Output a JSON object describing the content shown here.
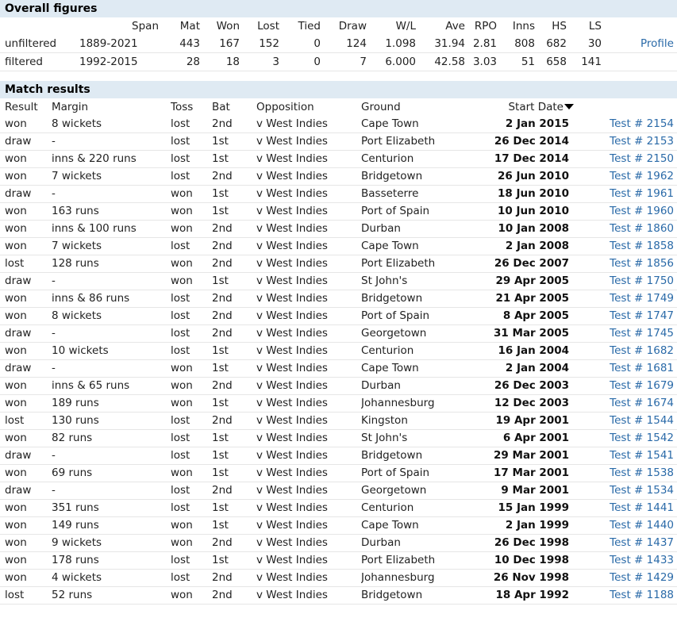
{
  "overall": {
    "title": "Overall figures",
    "headers": [
      "Span",
      "Mat",
      "Won",
      "Lost",
      "Tied",
      "Draw",
      "W/L",
      "Ave",
      "RPO",
      "Inns",
      "HS",
      "LS"
    ],
    "rows": [
      {
        "label": "unfiltered",
        "span": "1889-2021",
        "mat": "443",
        "won": "167",
        "lost": "152",
        "tied": "0",
        "draw": "124",
        "wl": "1.098",
        "ave": "31.94",
        "rpo": "2.81",
        "inns": "808",
        "hs": "682",
        "ls": "30",
        "link": "Profile"
      },
      {
        "label": "filtered",
        "span": "1992-2015",
        "mat": "28",
        "won": "18",
        "lost": "3",
        "tied": "0",
        "draw": "7",
        "wl": "6.000",
        "ave": "42.58",
        "rpo": "3.03",
        "inns": "51",
        "hs": "658",
        "ls": "141",
        "link": ""
      }
    ]
  },
  "results": {
    "title": "Match results",
    "headers": {
      "result": "Result",
      "margin": "Margin",
      "toss": "Toss",
      "bat": "Bat",
      "opposition": "Opposition",
      "ground": "Ground",
      "start_date": "Start Date"
    },
    "rows": [
      {
        "result": "won",
        "margin": "8 wickets",
        "toss": "lost",
        "bat": "2nd",
        "opposition": "v West Indies",
        "ground": "Cape Town",
        "date": "2 Jan 2015",
        "test": "Test # 2154"
      },
      {
        "result": "draw",
        "margin": "-",
        "toss": "lost",
        "bat": "1st",
        "opposition": "v West Indies",
        "ground": "Port Elizabeth",
        "date": "26 Dec 2014",
        "test": "Test # 2153"
      },
      {
        "result": "won",
        "margin": "inns & 220 runs",
        "toss": "lost",
        "bat": "1st",
        "opposition": "v West Indies",
        "ground": "Centurion",
        "date": "17 Dec 2014",
        "test": "Test # 2150"
      },
      {
        "result": "won",
        "margin": "7 wickets",
        "toss": "lost",
        "bat": "2nd",
        "opposition": "v West Indies",
        "ground": "Bridgetown",
        "date": "26 Jun 2010",
        "test": "Test # 1962"
      },
      {
        "result": "draw",
        "margin": "-",
        "toss": "won",
        "bat": "1st",
        "opposition": "v West Indies",
        "ground": "Basseterre",
        "date": "18 Jun 2010",
        "test": "Test # 1961"
      },
      {
        "result": "won",
        "margin": "163 runs",
        "toss": "won",
        "bat": "1st",
        "opposition": "v West Indies",
        "ground": "Port of Spain",
        "date": "10 Jun 2010",
        "test": "Test # 1960"
      },
      {
        "result": "won",
        "margin": "inns & 100 runs",
        "toss": "won",
        "bat": "2nd",
        "opposition": "v West Indies",
        "ground": "Durban",
        "date": "10 Jan 2008",
        "test": "Test # 1860"
      },
      {
        "result": "won",
        "margin": "7 wickets",
        "toss": "lost",
        "bat": "2nd",
        "opposition": "v West Indies",
        "ground": "Cape Town",
        "date": "2 Jan 2008",
        "test": "Test # 1858"
      },
      {
        "result": "lost",
        "margin": "128 runs",
        "toss": "won",
        "bat": "2nd",
        "opposition": "v West Indies",
        "ground": "Port Elizabeth",
        "date": "26 Dec 2007",
        "test": "Test # 1856"
      },
      {
        "result": "draw",
        "margin": "-",
        "toss": "won",
        "bat": "1st",
        "opposition": "v West Indies",
        "ground": "St John's",
        "date": "29 Apr 2005",
        "test": "Test # 1750"
      },
      {
        "result": "won",
        "margin": "inns & 86 runs",
        "toss": "lost",
        "bat": "2nd",
        "opposition": "v West Indies",
        "ground": "Bridgetown",
        "date": "21 Apr 2005",
        "test": "Test # 1749"
      },
      {
        "result": "won",
        "margin": "8 wickets",
        "toss": "lost",
        "bat": "2nd",
        "opposition": "v West Indies",
        "ground": "Port of Spain",
        "date": "8 Apr 2005",
        "test": "Test # 1747"
      },
      {
        "result": "draw",
        "margin": "-",
        "toss": "lost",
        "bat": "2nd",
        "opposition": "v West Indies",
        "ground": "Georgetown",
        "date": "31 Mar 2005",
        "test": "Test # 1745"
      },
      {
        "result": "won",
        "margin": "10 wickets",
        "toss": "lost",
        "bat": "1st",
        "opposition": "v West Indies",
        "ground": "Centurion",
        "date": "16 Jan 2004",
        "test": "Test # 1682"
      },
      {
        "result": "draw",
        "margin": "-",
        "toss": "won",
        "bat": "1st",
        "opposition": "v West Indies",
        "ground": "Cape Town",
        "date": "2 Jan 2004",
        "test": "Test # 1681"
      },
      {
        "result": "won",
        "margin": "inns & 65 runs",
        "toss": "won",
        "bat": "2nd",
        "opposition": "v West Indies",
        "ground": "Durban",
        "date": "26 Dec 2003",
        "test": "Test # 1679"
      },
      {
        "result": "won",
        "margin": "189 runs",
        "toss": "won",
        "bat": "1st",
        "opposition": "v West Indies",
        "ground": "Johannesburg",
        "date": "12 Dec 2003",
        "test": "Test # 1674"
      },
      {
        "result": "lost",
        "margin": "130 runs",
        "toss": "lost",
        "bat": "2nd",
        "opposition": "v West Indies",
        "ground": "Kingston",
        "date": "19 Apr 2001",
        "test": "Test # 1544"
      },
      {
        "result": "won",
        "margin": "82 runs",
        "toss": "lost",
        "bat": "1st",
        "opposition": "v West Indies",
        "ground": "St John's",
        "date": "6 Apr 2001",
        "test": "Test # 1542"
      },
      {
        "result": "draw",
        "margin": "-",
        "toss": "lost",
        "bat": "1st",
        "opposition": "v West Indies",
        "ground": "Bridgetown",
        "date": "29 Mar 2001",
        "test": "Test # 1541"
      },
      {
        "result": "won",
        "margin": "69 runs",
        "toss": "won",
        "bat": "1st",
        "opposition": "v West Indies",
        "ground": "Port of Spain",
        "date": "17 Mar 2001",
        "test": "Test # 1538"
      },
      {
        "result": "draw",
        "margin": "-",
        "toss": "lost",
        "bat": "2nd",
        "opposition": "v West Indies",
        "ground": "Georgetown",
        "date": "9 Mar 2001",
        "test": "Test # 1534"
      },
      {
        "result": "won",
        "margin": "351 runs",
        "toss": "lost",
        "bat": "1st",
        "opposition": "v West Indies",
        "ground": "Centurion",
        "date": "15 Jan 1999",
        "test": "Test # 1441"
      },
      {
        "result": "won",
        "margin": "149 runs",
        "toss": "won",
        "bat": "1st",
        "opposition": "v West Indies",
        "ground": "Cape Town",
        "date": "2 Jan 1999",
        "test": "Test # 1440"
      },
      {
        "result": "won",
        "margin": "9 wickets",
        "toss": "won",
        "bat": "2nd",
        "opposition": "v West Indies",
        "ground": "Durban",
        "date": "26 Dec 1998",
        "test": "Test # 1437"
      },
      {
        "result": "won",
        "margin": "178 runs",
        "toss": "lost",
        "bat": "1st",
        "opposition": "v West Indies",
        "ground": "Port Elizabeth",
        "date": "10 Dec 1998",
        "test": "Test # 1433"
      },
      {
        "result": "won",
        "margin": "4 wickets",
        "toss": "lost",
        "bat": "2nd",
        "opposition": "v West Indies",
        "ground": "Johannesburg",
        "date": "26 Nov 1998",
        "test": "Test # 1429"
      },
      {
        "result": "lost",
        "margin": "52 runs",
        "toss": "won",
        "bat": "2nd",
        "opposition": "v West Indies",
        "ground": "Bridgetown",
        "date": "18 Apr 1992",
        "test": "Test # 1188"
      }
    ]
  },
  "colors": {
    "header_bg": "#dfeaf3",
    "link": "#2a6aa8",
    "row_border": "#e6e6e6"
  }
}
